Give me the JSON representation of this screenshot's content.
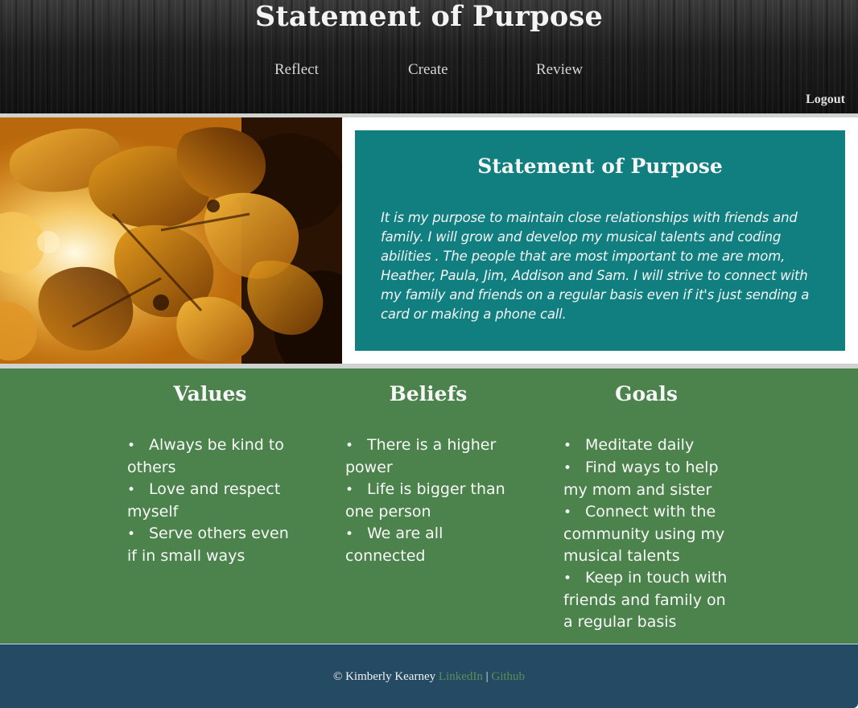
{
  "header": {
    "title": "Statement of Purpose",
    "nav": [
      "Reflect",
      "Create",
      "Review"
    ],
    "logout": "Logout"
  },
  "purpose": {
    "title": "Statement of Purpose",
    "text": "It is my purpose to maintain close relationships with friends and family. I will grow and develop my musical talents and coding abilities . The people that are most important to me are mom, Heather, Paula, Jim, Addison and Sam. I will strive to connect with my family and friends on a regular basis even if it's just sending a card or making a phone call."
  },
  "columns": [
    {
      "heading": "Values",
      "items": [
        "Always be kind to others",
        "Love and respect myself",
        "Serve others even if in small ways"
      ]
    },
    {
      "heading": "Beliefs",
      "items": [
        "There is a higher power",
        "Life is bigger than one person",
        "We are all connected"
      ]
    },
    {
      "heading": "Goals",
      "items": [
        "Meditate daily",
        "Find ways to help my mom and sister",
        "Connect with the community using my musical talents",
        "Keep in touch with friends and family on a regular basis"
      ]
    }
  ],
  "footer": {
    "copyright": "© Kimberly Kearney",
    "linkedin": "LinkedIn",
    "separator": "|",
    "github": "Github"
  },
  "colors": {
    "header_bg": "#1a1a1a",
    "purpose_bg": "#117f80",
    "section_green": "#4c824c",
    "footer_bg": "#254a63",
    "footer_link": "#5c8c58"
  }
}
